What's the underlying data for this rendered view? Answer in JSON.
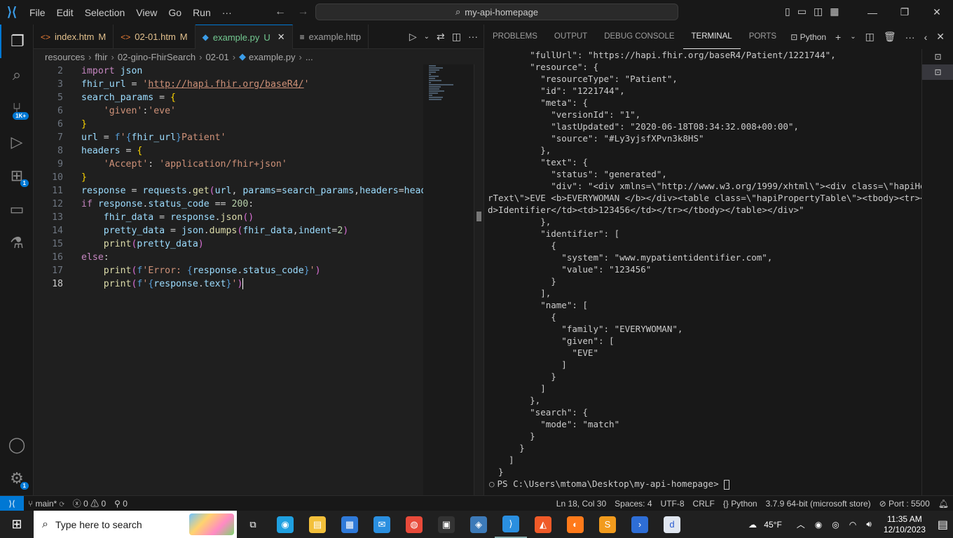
{
  "titlebar": {
    "menu": [
      "File",
      "Edit",
      "Selection",
      "View",
      "Go",
      "Run",
      "···"
    ],
    "search_text": "my-api-homepage",
    "window_controls": {
      "minimize": "—",
      "restore": "❐",
      "close": "✕"
    }
  },
  "activity_bar": {
    "items": [
      {
        "name": "explorer-icon",
        "glyph": "❐"
      },
      {
        "name": "search-icon",
        "glyph": "⌕"
      },
      {
        "name": "source-control-icon",
        "glyph": "⑂",
        "badge": "1K+"
      },
      {
        "name": "run-debug-icon",
        "glyph": "▷"
      },
      {
        "name": "extensions-icon",
        "glyph": "⊞",
        "badge": "1"
      },
      {
        "name": "remote-explorer-icon",
        "glyph": "▭"
      },
      {
        "name": "testing-icon",
        "glyph": "⚗"
      }
    ],
    "bottom": [
      {
        "name": "accounts-icon",
        "glyph": "◯"
      },
      {
        "name": "manage-gear-icon",
        "glyph": "⚙",
        "badge": "1"
      }
    ]
  },
  "tabs": [
    {
      "icon": "<>",
      "label": "index.htm",
      "status": "M",
      "active": false,
      "color": "#e37933"
    },
    {
      "icon": "<>",
      "label": "02-01.htm",
      "status": "M",
      "active": false,
      "color": "#e37933"
    },
    {
      "icon": "◆",
      "label": "example.py",
      "status": "U",
      "active": true,
      "color": "#3b9de8"
    },
    {
      "icon": "≡",
      "label": "example.http",
      "status": "",
      "active": false,
      "color": "#cccccc"
    }
  ],
  "breadcrumb": [
    "resources",
    "fhir",
    "02-gino-FhirSearch",
    "02-01",
    "example.py",
    "..."
  ],
  "editor": {
    "lines": [
      {
        "n": "2",
        "tokens": [
          [
            "k",
            "import"
          ],
          [
            "p",
            " "
          ],
          [
            "v",
            "json"
          ]
        ]
      },
      {
        "n": "3",
        "tokens": [
          [
            "v",
            "fhir_url"
          ],
          [
            "p",
            " = "
          ],
          [
            "s",
            "'"
          ],
          [
            "u",
            "http://hapi.fhir.org/baseR4/"
          ],
          [
            "s",
            "'"
          ]
        ]
      },
      {
        "n": "5",
        "tokens": [
          [
            "v",
            "search_params"
          ],
          [
            "p",
            " = "
          ],
          [
            "y",
            "{"
          ]
        ]
      },
      {
        "n": "6",
        "tokens": [
          [
            "p",
            "    "
          ],
          [
            "s",
            "'given'"
          ],
          [
            "p",
            ":"
          ],
          [
            "s",
            "'eve'"
          ]
        ]
      },
      {
        "n": "6",
        "tokens": [
          [
            "y",
            "}"
          ]
        ]
      },
      {
        "n": "7",
        "tokens": [
          [
            "v",
            "url"
          ],
          [
            "p",
            " = "
          ],
          [
            "b",
            "f"
          ],
          [
            "s",
            "'"
          ],
          [
            "b",
            "{"
          ],
          [
            "v",
            "fhir_url"
          ],
          [
            "b",
            "}"
          ],
          [
            "s",
            "Patient'"
          ]
        ]
      },
      {
        "n": "8",
        "tokens": [
          [
            "v",
            "headers"
          ],
          [
            "p",
            " = "
          ],
          [
            "y",
            "{"
          ]
        ]
      },
      {
        "n": "9",
        "tokens": [
          [
            "p",
            "    "
          ],
          [
            "s",
            "'Accept'"
          ],
          [
            "p",
            ": "
          ],
          [
            "s",
            "'application/fhir+json'"
          ]
        ]
      },
      {
        "n": "10",
        "tokens": [
          [
            "y",
            "}"
          ]
        ]
      },
      {
        "n": "11",
        "tokens": [
          [
            "v",
            "response"
          ],
          [
            "p",
            " = "
          ],
          [
            "v",
            "requests"
          ],
          [
            "p",
            "."
          ],
          [
            "f",
            "get"
          ],
          [
            "m",
            "("
          ],
          [
            "v",
            "url"
          ],
          [
            "p",
            ", "
          ],
          [
            "v",
            "params"
          ],
          [
            "p",
            "="
          ],
          [
            "v",
            "search_params"
          ],
          [
            "p",
            ","
          ],
          [
            "v",
            "headers"
          ],
          [
            "p",
            "="
          ],
          [
            "v",
            "header"
          ]
        ]
      },
      {
        "n": "12",
        "tokens": [
          [
            "k",
            "if"
          ],
          [
            "p",
            " "
          ],
          [
            "v",
            "response"
          ],
          [
            "p",
            "."
          ],
          [
            "v",
            "status_code"
          ],
          [
            "p",
            " == "
          ],
          [
            "n",
            "200"
          ],
          [
            "p",
            ":"
          ]
        ]
      },
      {
        "n": "13",
        "tokens": [
          [
            "p",
            "    "
          ],
          [
            "v",
            "fhir_data"
          ],
          [
            "p",
            " = "
          ],
          [
            "v",
            "response"
          ],
          [
            "p",
            "."
          ],
          [
            "f",
            "json"
          ],
          [
            "m",
            "()"
          ]
        ]
      },
      {
        "n": "14",
        "tokens": [
          [
            "p",
            "    "
          ],
          [
            "v",
            "pretty_data"
          ],
          [
            "p",
            " = "
          ],
          [
            "v",
            "json"
          ],
          [
            "p",
            "."
          ],
          [
            "f",
            "dumps"
          ],
          [
            "m",
            "("
          ],
          [
            "v",
            "fhir_data"
          ],
          [
            "p",
            ","
          ],
          [
            "v",
            "indent"
          ],
          [
            "p",
            "="
          ],
          [
            "n",
            "2"
          ],
          [
            "m",
            ")"
          ]
        ]
      },
      {
        "n": "15",
        "tokens": [
          [
            "p",
            "    "
          ],
          [
            "f",
            "print"
          ],
          [
            "m",
            "("
          ],
          [
            "v",
            "pretty_data"
          ],
          [
            "m",
            ")"
          ]
        ]
      },
      {
        "n": "16",
        "tokens": [
          [
            "k",
            "else"
          ],
          [
            "p",
            ":"
          ]
        ]
      },
      {
        "n": "17",
        "tokens": [
          [
            "p",
            "    "
          ],
          [
            "f",
            "print"
          ],
          [
            "m",
            "("
          ],
          [
            "b",
            "f"
          ],
          [
            "s",
            "'Error: "
          ],
          [
            "b",
            "{"
          ],
          [
            "v",
            "response"
          ],
          [
            "p",
            "."
          ],
          [
            "v",
            "status_code"
          ],
          [
            "b",
            "}"
          ],
          [
            "s",
            "'"
          ],
          [
            "m",
            ")"
          ]
        ]
      },
      {
        "n": "18",
        "tokens": [
          [
            "p",
            "    "
          ],
          [
            "f",
            "print"
          ],
          [
            "m",
            "("
          ],
          [
            "b",
            "f"
          ],
          [
            "s",
            "'"
          ],
          [
            "b",
            "{"
          ],
          [
            "v",
            "response"
          ],
          [
            "p",
            "."
          ],
          [
            "v",
            "text"
          ],
          [
            "b",
            "}"
          ],
          [
            "s",
            "'"
          ],
          [
            "m",
            ")"
          ]
        ],
        "current": true
      }
    ]
  },
  "panel": {
    "tabs": [
      "PROBLEMS",
      "OUTPUT",
      "DEBUG CONSOLE",
      "TERMINAL",
      "PORTS"
    ],
    "active_tab": "TERMINAL",
    "terminal_profile": "Python"
  },
  "terminal": {
    "lines": [
      "      \"fullUrl\": \"https://hapi.fhir.org/baseR4/Patient/1221744\",",
      "      \"resource\": {",
      "        \"resourceType\": \"Patient\",",
      "        \"id\": \"1221744\",",
      "        \"meta\": {",
      "          \"versionId\": \"1\",",
      "          \"lastUpdated\": \"2020-06-18T08:34:32.008+00:00\",",
      "          \"source\": \"#Ly3yjsfXPvn3k8HS\"",
      "        },",
      "        \"text\": {",
      "          \"status\": \"generated\",",
      "          \"div\": \"<div xmlns=\\\"http://www.w3.org/1999/xhtml\\\"><div class=\\\"hapiHeade",
      "rText\\\">EVE <b>EVERYWOMAN </b></div><table class=\\\"hapiPropertyTable\\\"><tbody><tr><t",
      "d>Identifier</td><td>123456</td></tr></tbody></table></div>\"",
      "        },",
      "        \"identifier\": [",
      "          {",
      "            \"system\": \"www.mypatientidentifier.com\",",
      "            \"value\": \"123456\"",
      "          }",
      "        ],",
      "        \"name\": [",
      "          {",
      "            \"family\": \"EVERYWOMAN\",",
      "            \"given\": [",
      "              \"EVE\"",
      "            ]",
      "          }",
      "        ]",
      "      },",
      "      \"search\": {",
      "        \"mode\": \"match\"",
      "      }",
      "    }",
      "  ]",
      "}"
    ],
    "prompt": "PS C:\\Users\\mtoma\\Desktop\\my-api-homepage> "
  },
  "statusbar": {
    "branch": "main*",
    "errors": "0",
    "warnings": "0",
    "ports_forwarded": "0",
    "position": "Ln 18, Col 30",
    "spaces": "Spaces: 4",
    "encoding": "UTF-8",
    "eol": "CRLF",
    "language": "Python",
    "interpreter": "3.7.9 64-bit (microsoft store)",
    "port": "Port : 5500"
  },
  "taskbar": {
    "search_placeholder": "Type here to search",
    "weather": "45°F",
    "time": "11:35 AM",
    "date": "12/10/2023",
    "apps": [
      {
        "name": "task-view-icon",
        "color": "#ffffff",
        "glyph": "⧉"
      },
      {
        "name": "edge-icon",
        "color": "#1fa0e0",
        "glyph": "◉"
      },
      {
        "name": "file-explorer-icon",
        "color": "#f3c03a",
        "glyph": "▤"
      },
      {
        "name": "store-icon",
        "color": "#2f7ad9",
        "glyph": "▦"
      },
      {
        "name": "mail-icon",
        "color": "#2a8fe0",
        "glyph": "✉"
      },
      {
        "name": "chrome-icon",
        "color": "#e84a3a",
        "glyph": "◍"
      },
      {
        "name": "terminal-app-icon",
        "color": "#333333",
        "glyph": "▣"
      },
      {
        "name": "python-app-icon",
        "color": "#3d7ab8",
        "glyph": "◈"
      },
      {
        "name": "vscode-app-icon",
        "color": "#2a8fe0",
        "glyph": "⟩"
      },
      {
        "name": "brave-icon",
        "color": "#f05a28",
        "glyph": "◭"
      },
      {
        "name": "firefox-icon",
        "color": "#ff7a1a",
        "glyph": "◐"
      },
      {
        "name": "sublime-icon",
        "color": "#f29b1d",
        "glyph": "S"
      },
      {
        "name": "powershell-icon",
        "color": "#2e6ed6",
        "glyph": "›"
      },
      {
        "name": "dropbox-app-icon",
        "color": "#e0e6f0",
        "glyph": "d"
      }
    ]
  }
}
